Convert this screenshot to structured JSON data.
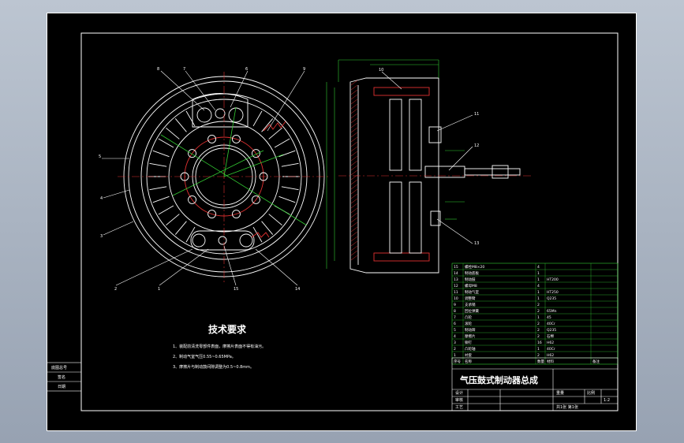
{
  "tech_requirements": {
    "heading": "技术要求",
    "items": [
      "1、装配前清洗零部件表面，摩擦片表面不得有油污。",
      "2、制动气室气压0.55~0.65MPa。",
      "3、摩擦片与制动鼓间隙调整为0.5~0.8mm。"
    ]
  },
  "drawing_title": "气压鼓式制动器总成",
  "part_numbers": {
    "front_view": [
      "8",
      "7",
      "6",
      "9",
      "5",
      "4",
      "3",
      "2",
      "1",
      "15",
      "14"
    ],
    "side_view": [
      "10",
      "11",
      "12",
      "13"
    ]
  },
  "side_labels": [
    "底图总号",
    "签名",
    "日期"
  ],
  "bom_rows": [
    {
      "no": "15",
      "name": "螺栓M8×20",
      "qty": "4",
      "material": ""
    },
    {
      "no": "14",
      "name": "制动底板",
      "qty": "1",
      "material": ""
    },
    {
      "no": "13",
      "name": "制动鼓",
      "qty": "1",
      "material": "HT200"
    },
    {
      "no": "12",
      "name": "螺母M8",
      "qty": "4",
      "material": ""
    },
    {
      "no": "11",
      "name": "制动气室",
      "qty": "1",
      "material": "HT250"
    },
    {
      "no": "10",
      "name": "调整臂",
      "qty": "1",
      "material": "Q235"
    },
    {
      "no": "9",
      "name": "支承销",
      "qty": "2",
      "material": ""
    },
    {
      "no": "8",
      "name": "回位弹簧",
      "qty": "2",
      "material": "65Mn"
    },
    {
      "no": "7",
      "name": "凸轮",
      "qty": "1",
      "material": "45"
    },
    {
      "no": "6",
      "name": "滚轮",
      "qty": "2",
      "material": "40Cr"
    },
    {
      "no": "5",
      "name": "制动蹄",
      "qty": "2",
      "material": "Q235"
    },
    {
      "no": "4",
      "name": "摩擦片",
      "qty": "2",
      "material": "石棉"
    },
    {
      "no": "3",
      "name": "铆钉",
      "qty": "16",
      "material": "H62"
    },
    {
      "no": "2",
      "name": "凸轮轴",
      "qty": "1",
      "material": "40Cr"
    },
    {
      "no": "1",
      "name": "衬套",
      "qty": "2",
      "material": "H62"
    }
  ],
  "title_block": {
    "header": [
      "序号",
      "名称",
      "数量",
      "材料",
      "备注"
    ],
    "row_labels": [
      "设计",
      "审核",
      "工艺"
    ],
    "scale_label": "比例",
    "scale": "1:2",
    "sheet": "共1张 第1张",
    "weight_label": "重量"
  },
  "colors": {
    "background": "#000000",
    "frame": "#ffffff",
    "center_lines": "#e03030",
    "dimension_lines": "#33cc33",
    "parts": "#ffffff"
  }
}
